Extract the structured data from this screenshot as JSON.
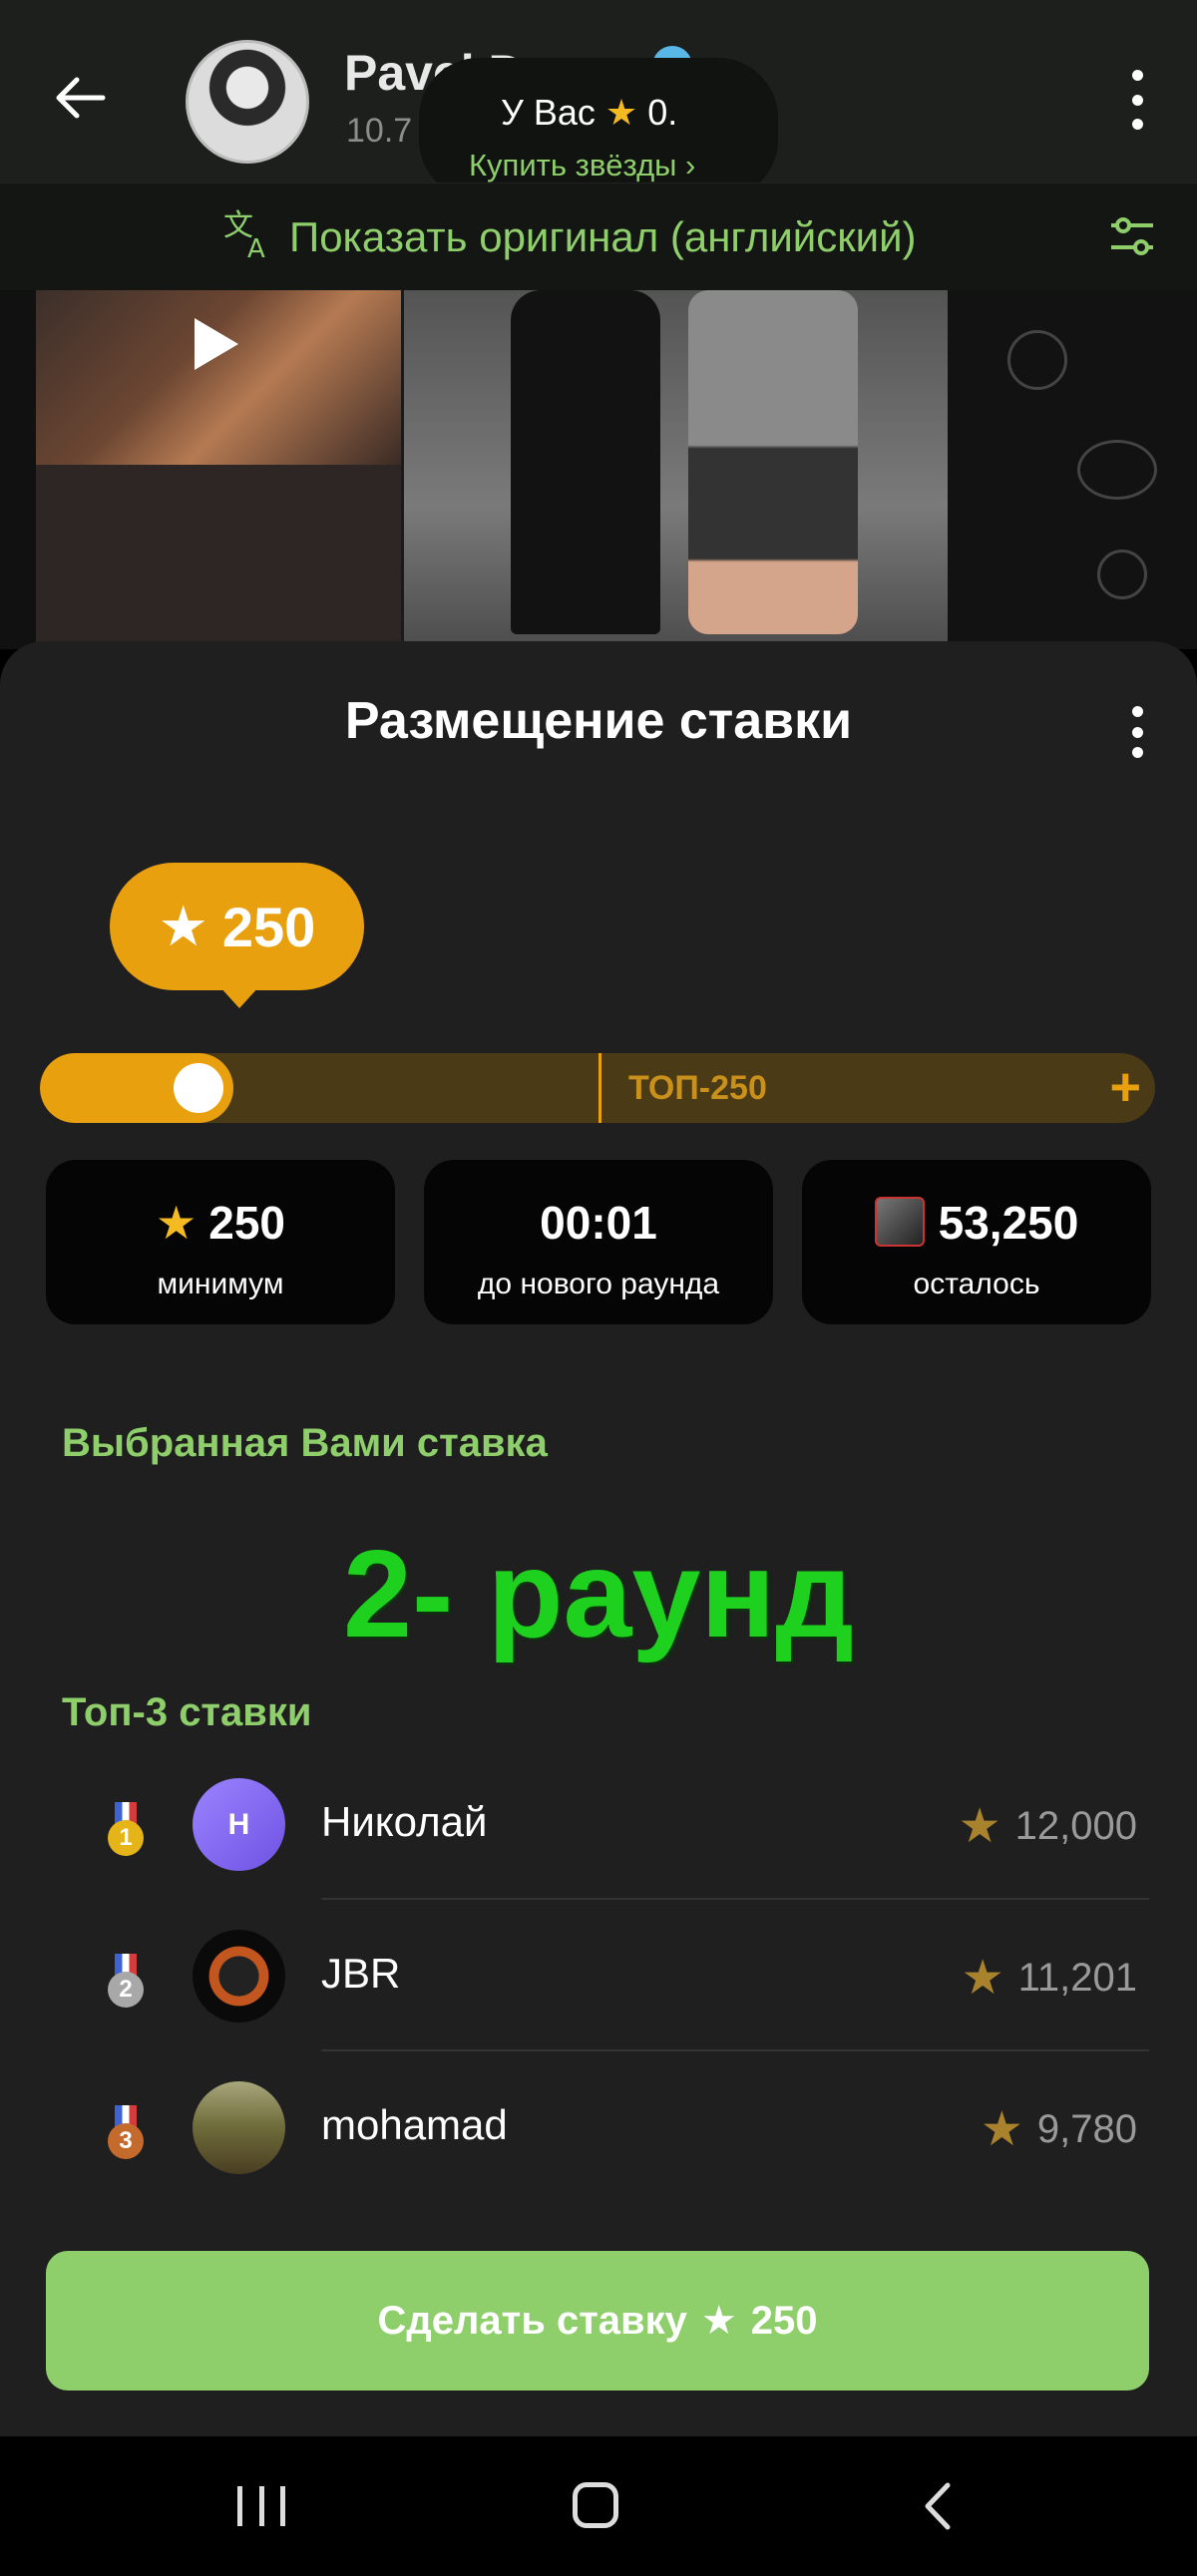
{
  "header": {
    "chat_name": "Pavel Durov",
    "chat_subtitle": "10.7",
    "stars_balance_text": "У Вас",
    "stars_balance_value": "0.",
    "buy_stars_link": "Купить звёзды ›"
  },
  "translate_bar": {
    "label": "Показать оригинал (английский)"
  },
  "sheet": {
    "title": "Размещение ставки",
    "bubble_value": "250",
    "slider": {
      "fill_fraction": 0.12,
      "marker_label": "ТОП-250",
      "plus": "+"
    },
    "stats": [
      {
        "value": "250",
        "label": "минимум",
        "icon": "star-icon"
      },
      {
        "value": "00:01",
        "label": "до нового раунда",
        "icon": ""
      },
      {
        "value": "53,250",
        "label": "осталось",
        "icon": "ufc-box-icon"
      }
    ],
    "selected_bet_title": "Выбранная Вами ставка",
    "selected_bet_value": "2- раунд",
    "top_title": "Топ-3 ставки",
    "top_bets": [
      {
        "rank": "1",
        "avatar_letter": "Н",
        "name": "Николай",
        "amount": "12,000"
      },
      {
        "rank": "2",
        "avatar_letter": "",
        "name": "JBR",
        "amount": "11,201"
      },
      {
        "rank": "3",
        "avatar_letter": "",
        "name": "mohamad",
        "amount": "9,780"
      }
    ],
    "bet_button_label": "Сделать ставку",
    "bet_button_value": "250"
  },
  "colors": {
    "accent_green": "#8fcf6b",
    "accent_gold": "#e9a00e",
    "round_green": "#1fd11f",
    "sheet_bg": "#1f1f1f"
  }
}
